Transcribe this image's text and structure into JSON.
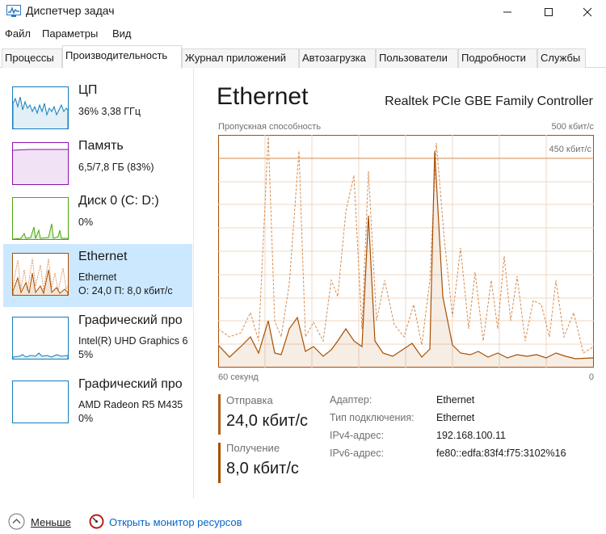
{
  "window": {
    "title": "Диспетчер задач"
  },
  "menu": [
    "Файл",
    "Параметры",
    "Вид"
  ],
  "tabs": [
    "Процессы",
    "Производительность",
    "Журнал приложений",
    "Автозагрузка",
    "Пользователи",
    "Подробности",
    "Службы"
  ],
  "active_tab": "Производительность",
  "sidebar": [
    {
      "name": "ЦП",
      "line1": "36%  3,38 ГГц",
      "line2": "",
      "color": "#117dbb",
      "selected": false
    },
    {
      "name": "Память",
      "line1": "6,5/7,8 ГБ (83%)",
      "line2": "",
      "color": "#8b12ae",
      "selected": false
    },
    {
      "name": "Диск 0 (C: D:)",
      "line1": "0%",
      "line2": "",
      "color": "#4da60c",
      "selected": false
    },
    {
      "name": "Ethernet",
      "line1": "Ethernet",
      "line2": "О: 24,0  П: 8,0 кбит/с",
      "color": "#a74f01",
      "selected": true
    },
    {
      "name": "Графический про",
      "line1": "Intel(R) UHD Graphics 6",
      "line2": "5%",
      "color": "#117dbb",
      "selected": false
    },
    {
      "name": "Графический про",
      "line1": "AMD Radeon R5 M435",
      "line2": "0%",
      "color": "#117dbb",
      "selected": false
    }
  ],
  "main": {
    "title": "Ethernet",
    "device": "Realtek PCIe GBE Family Controller",
    "graph_label": "Пропускная способность",
    "graph_max": "500 кбит/с",
    "graph_mark": "450 кбит/с",
    "time_left": "60 секунд",
    "time_right": "0",
    "send_label": "Отправка",
    "send_value": "24,0 кбит/с",
    "recv_label": "Получение",
    "recv_value": "8,0 кбит/с",
    "details": [
      {
        "key": "Адаптер:",
        "value": "Ethernet"
      },
      {
        "key": "Тип подключения:",
        "value": "Ethernet"
      },
      {
        "key": "IPv4-адрес:",
        "value": "192.168.100.11"
      },
      {
        "key": "IPv6-адрес:",
        "value": "fe80::edfa:83f4:f75:3102%16"
      }
    ]
  },
  "footer": {
    "less": "Меньше",
    "monitor": "Открыть монитор ресурсов"
  },
  "colors": {
    "accent": "#a74f01",
    "dashed": "#d58a4e",
    "grid": "#efd7c2",
    "selected": "#cce8ff",
    "link": "#0066cc"
  },
  "icons": [
    "task-manager-icon",
    "minimize-icon",
    "maximize-icon",
    "close-icon",
    "chevron-up-icon",
    "resource-monitor-icon"
  ]
}
